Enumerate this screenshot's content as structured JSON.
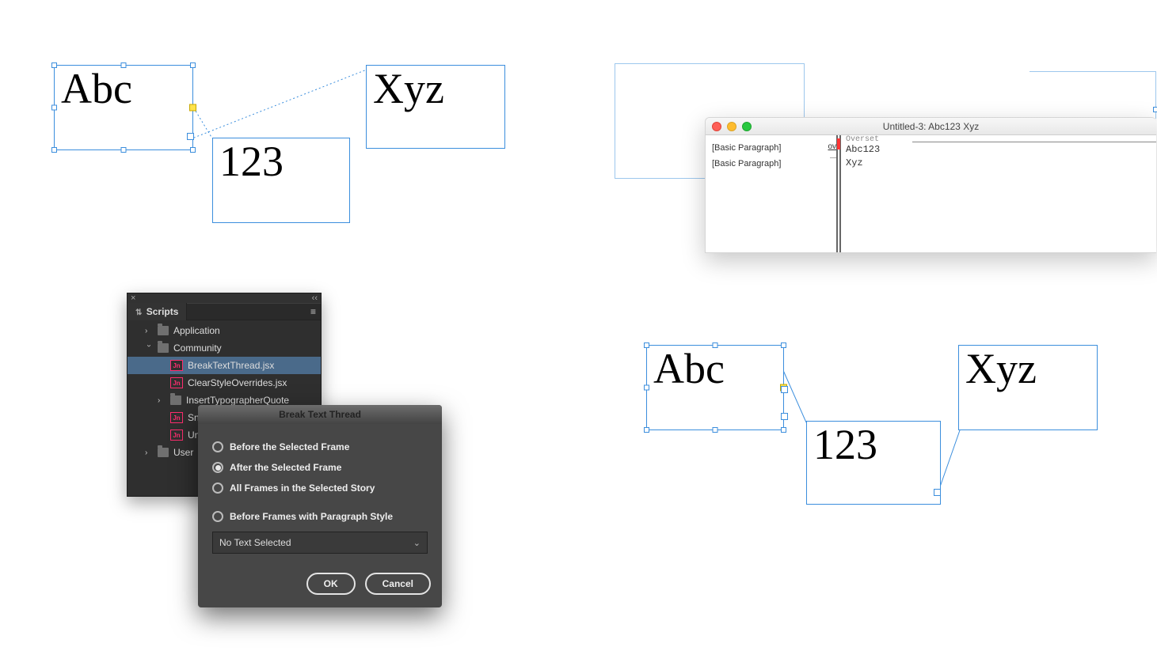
{
  "qa": {
    "frame1_text": "Abc",
    "frame2_text": "123",
    "frame3_text": "Xyz"
  },
  "qb": {
    "window_title": "Untitled-3: Abc123 Xyz",
    "para_style": "[Basic Paragraph]",
    "ov_label": "ov",
    "overset_label": "Overset",
    "line1": "Abc123",
    "line2": "Xyz"
  },
  "qc": {
    "panel_title": "Scripts",
    "tree": {
      "application": "Application",
      "community": "Community",
      "user": "User",
      "scripts": {
        "break": "BreakTextThread.jsx",
        "clear": "ClearStyleOverrides.jsx",
        "insert": "InsertTypographerQuote",
        "snap": "Snap",
        "unicode": "Unic"
      }
    },
    "dialog": {
      "title": "Break Text Thread",
      "opt1": "Before the Selected Frame",
      "opt2": "After the Selected Frame",
      "opt3": "All Frames in the Selected Story",
      "opt4": "Before Frames with Paragraph Style",
      "select_value": "No Text Selected",
      "ok": "OK",
      "cancel": "Cancel"
    }
  },
  "qd": {
    "frame1_text": "Abc",
    "frame2_text": "123",
    "frame3_text": "Xyz"
  }
}
